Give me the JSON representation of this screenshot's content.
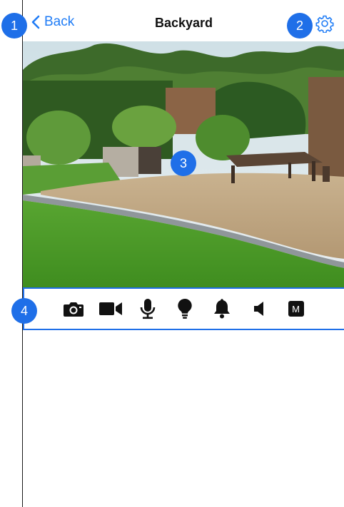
{
  "nav": {
    "back_label": "Back",
    "title": "Backyard"
  },
  "badges": [
    "1",
    "2",
    "3",
    "4"
  ],
  "toolbar": {
    "items": [
      "camera-icon",
      "video-camera-icon",
      "microphone-icon",
      "light-bulb-icon",
      "bell-icon",
      "speaker-icon",
      "m-mode-icon"
    ],
    "m_label": "M"
  },
  "colors": {
    "accent": "#1f7cf6",
    "badge": "#1f6fe8",
    "icon": "#111111"
  }
}
